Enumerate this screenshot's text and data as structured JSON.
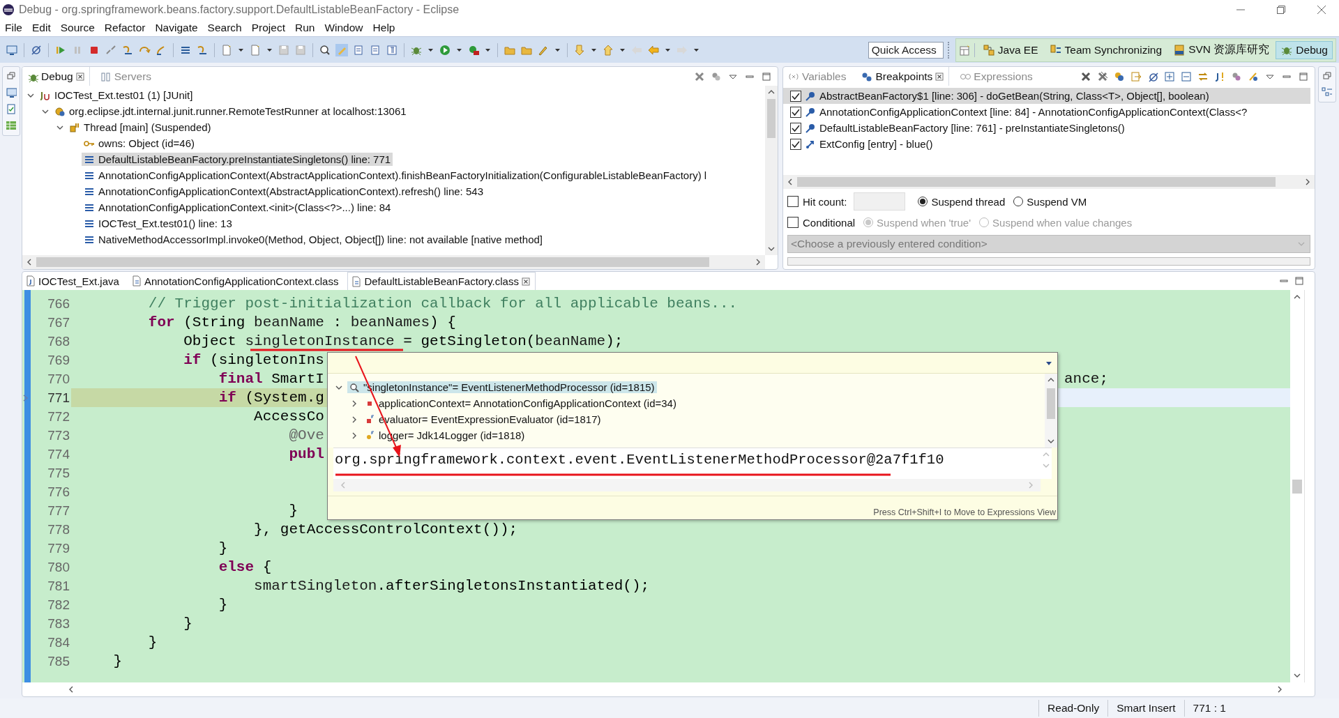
{
  "window": {
    "title": "Debug - org.springframework.beans.factory.support.DefaultListableBeanFactory - Eclipse"
  },
  "menu": [
    "File",
    "Edit",
    "Source",
    "Refactor",
    "Navigate",
    "Search",
    "Project",
    "Run",
    "Window",
    "Help"
  ],
  "quick_access": {
    "placeholder": "Quick Access"
  },
  "perspectives": [
    {
      "label": "Java EE",
      "selected": false
    },
    {
      "label": "Team Synchronizing",
      "selected": false
    },
    {
      "label": "SVN 资源库研究",
      "selected": false
    },
    {
      "label": "Debug",
      "selected": true
    }
  ],
  "debug_view": {
    "tabs": [
      {
        "label": "Debug",
        "selected": true
      },
      {
        "label": "Servers",
        "selected": false
      }
    ],
    "tree": [
      {
        "label": "IOCTest_Ext.test01 (1) [JUnit]",
        "kind": "launch",
        "expanded": true,
        "selected": false,
        "children": [
          {
            "label": "org.eclipse.jdt.internal.junit.runner.RemoteTestRunner at localhost:13061",
            "kind": "target",
            "expanded": true,
            "selected": false,
            "children": [
              {
                "label": "Thread [main] (Suspended)",
                "kind": "thread",
                "expanded": true,
                "selected": false,
                "children": [
                  {
                    "label": "owns: Object  (id=46)",
                    "kind": "monitor",
                    "selected": false
                  },
                  {
                    "label": "DefaultListableBeanFactory.preInstantiateSingletons() line: 771",
                    "kind": "frame",
                    "selected": true
                  },
                  {
                    "label": "AnnotationConfigApplicationContext(AbstractApplicationContext).finishBeanFactoryInitialization(ConfigurableListableBeanFactory) l",
                    "kind": "frame",
                    "selected": false
                  },
                  {
                    "label": "AnnotationConfigApplicationContext(AbstractApplicationContext).refresh() line: 543",
                    "kind": "frame",
                    "selected": false
                  },
                  {
                    "label": "AnnotationConfigApplicationContext.<init>(Class<?>...) line: 84",
                    "kind": "frame",
                    "selected": false
                  },
                  {
                    "label": "IOCTest_Ext.test01() line: 13",
                    "kind": "frame",
                    "selected": false
                  },
                  {
                    "label": "NativeMethodAccessorImpl.invoke0(Method, Object, Object[]) line: not available [native method]",
                    "kind": "frame",
                    "selected": false
                  }
                ]
              }
            ]
          }
        ]
      }
    ]
  },
  "breakpoints_view": {
    "tabs": [
      {
        "label": "Variables",
        "selected": false
      },
      {
        "label": "Breakpoints",
        "selected": true
      },
      {
        "label": "Expressions",
        "selected": false
      }
    ],
    "breakpoints": [
      {
        "label": "AbstractBeanFactory$1 [line: 306] - doGetBean(String, Class<T>, Object[], boolean)",
        "kind": "line",
        "checked": true,
        "selected": true
      },
      {
        "label": "AnnotationConfigApplicationContext [line: 84] - AnnotationConfigApplicationContext(Class<?",
        "kind": "line",
        "checked": true,
        "selected": false
      },
      {
        "label": "DefaultListableBeanFactory [line: 761] - preInstantiateSingletons()",
        "kind": "line",
        "checked": true,
        "selected": false
      },
      {
        "label": "ExtConfig [entry] - blue()",
        "kind": "method",
        "checked": true,
        "selected": false
      }
    ],
    "hit_count": {
      "label": "Hit count:",
      "checked": false
    },
    "suspend_options": [
      {
        "label": "Suspend thread",
        "selected": true
      },
      {
        "label": "Suspend VM",
        "selected": false
      }
    ],
    "conditional": {
      "label": "Conditional",
      "checked": false
    },
    "condition_options": [
      {
        "label": "Suspend when 'true'",
        "selected": true,
        "disabled": true
      },
      {
        "label": "Suspend when value changes",
        "selected": false,
        "disabled": true
      }
    ],
    "condition_combo": {
      "placeholder": "<Choose a previously entered condition>",
      "disabled": true
    }
  },
  "editor": {
    "tabs": [
      {
        "label": "IOCTest_Ext.java",
        "kind": "java",
        "selected": false
      },
      {
        "label": "AnnotationConfigApplicationContext.class",
        "kind": "class",
        "selected": false
      },
      {
        "label": "DefaultListableBeanFactory.class",
        "kind": "class",
        "selected": true
      }
    ],
    "lines": [
      {
        "number": "766",
        "current": false,
        "tokens": [
          {
            "text": "        // Trigger post-initialization callback for all applicable beans...",
            "kind": "comment"
          }
        ]
      },
      {
        "number": "767",
        "current": false,
        "tokens": [
          {
            "text": "        for",
            "kind": "keyword"
          },
          {
            "text": " (String ",
            "kind": "plain"
          },
          {
            "text": "beanName",
            "kind": "local"
          },
          {
            "text": " : ",
            "kind": "plain"
          },
          {
            "text": "beanNames",
            "kind": "local"
          },
          {
            "text": ") {",
            "kind": "plain"
          }
        ]
      },
      {
        "number": "768",
        "current": false,
        "tokens": [
          {
            "text": "            Object ",
            "kind": "plain"
          },
          {
            "text": "singletonInstance",
            "kind": "local"
          },
          {
            "text": " = getSingleton(",
            "kind": "plain"
          },
          {
            "text": "beanName",
            "kind": "local"
          },
          {
            "text": ");",
            "kind": "plain"
          }
        ]
      },
      {
        "number": "769",
        "current": false,
        "tokens": [
          {
            "text": "            if",
            "kind": "keyword"
          },
          {
            "text": " (singletonIns",
            "kind": "plain"
          }
        ]
      },
      {
        "number": "770",
        "current": false,
        "tokens": [
          {
            "text": "                final",
            "kind": "keyword"
          },
          {
            "text": " SmartI",
            "kind": "plain"
          }
        ],
        "tail": "ance;"
      },
      {
        "number": "771",
        "current": true,
        "tokens": [
          {
            "text": "                if",
            "kind": "keyword"
          },
          {
            "text": " (System.g",
            "kind": "plain"
          }
        ]
      },
      {
        "number": "772",
        "current": false,
        "tokens": [
          {
            "text": "                    AccessCo",
            "kind": "plain"
          }
        ]
      },
      {
        "number": "773",
        "current": false,
        "tokens": [
          {
            "text": "                        @Ove",
            "kind": "annotation"
          }
        ]
      },
      {
        "number": "774",
        "current": false,
        "tokens": [
          {
            "text": "                        publ",
            "kind": "keyword"
          }
        ]
      },
      {
        "number": "775",
        "current": false
      },
      {
        "number": "776",
        "current": false
      },
      {
        "number": "777",
        "current": false,
        "tokens": [
          {
            "text": "                        }",
            "kind": "plain"
          }
        ]
      },
      {
        "number": "778",
        "current": false,
        "tokens": [
          {
            "text": "                    }, getAccessControlContext());",
            "kind": "plain"
          }
        ]
      },
      {
        "number": "779",
        "current": false,
        "tokens": [
          {
            "text": "                }",
            "kind": "plain"
          }
        ]
      },
      {
        "number": "780",
        "current": false,
        "tokens": [
          {
            "text": "                else",
            "kind": "keyword"
          },
          {
            "text": " {",
            "kind": "plain"
          }
        ]
      },
      {
        "number": "781",
        "current": false,
        "tokens": [
          {
            "text": "                    smartSingleton",
            "kind": "local"
          },
          {
            "text": ".afterSingletonsInstantiated();",
            "kind": "plain"
          }
        ]
      },
      {
        "number": "782",
        "current": false,
        "tokens": [
          {
            "text": "                }",
            "kind": "plain"
          }
        ]
      },
      {
        "number": "783",
        "current": false,
        "tokens": [
          {
            "text": "            }",
            "kind": "plain"
          }
        ]
      },
      {
        "number": "784",
        "current": false,
        "tokens": [
          {
            "text": "        }",
            "kind": "plain"
          }
        ]
      },
      {
        "number": "785",
        "current": false,
        "tokens": [
          {
            "text": "    }",
            "kind": "plain"
          }
        ]
      }
    ],
    "hover": {
      "tree": [
        {
          "label": "\"singletonInstance\"= EventListenerMethodProcessor  (id=1815)",
          "kind": "root",
          "expanded": true,
          "selected": true
        },
        {
          "label": "applicationContext= AnnotationConfigApplicationContext  (id=34)",
          "kind": "private",
          "expanded": false,
          "selected": false
        },
        {
          "label": "evaluator= EventExpressionEvaluator  (id=1817)",
          "kind": "private-final",
          "expanded": false,
          "selected": false
        },
        {
          "label": "logger= Jdk14Logger  (id=1818)",
          "kind": "static-final",
          "expanded": false,
          "selected": false
        }
      ],
      "value": "org.springframework.context.event.EventListenerMethodProcessor@2a7f1f10",
      "hint": "Press Ctrl+Shift+I to Move to Expressions View"
    }
  },
  "status_bar": [
    "Read-Only",
    "Smart Insert",
    "771 : 1"
  ]
}
